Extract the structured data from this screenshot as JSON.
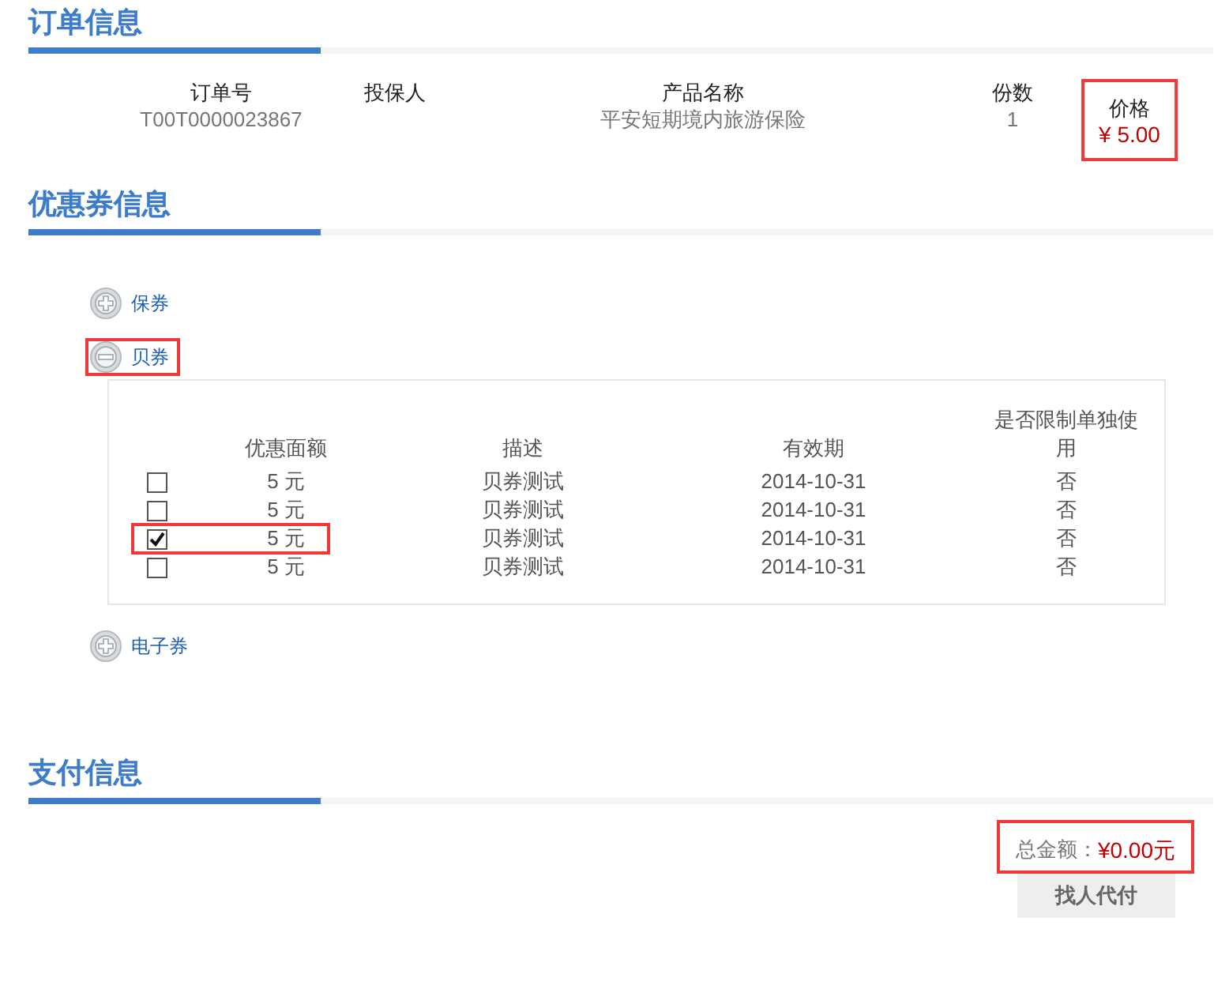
{
  "order": {
    "title": "订单信息",
    "columns": [
      {
        "header": "订单号",
        "value": "T00T0000023867",
        "highlighted": false
      },
      {
        "header": "投保人",
        "highlighted": false
      },
      {
        "header": "产品名称",
        "value": "平安短期境内旅游保险",
        "highlighted": false
      },
      {
        "header": "份数",
        "value": "1",
        "highlighted": false
      },
      {
        "header": "价格",
        "value": "¥ 5.00",
        "kind": "price",
        "highlighted": true
      }
    ]
  },
  "coupons": {
    "title": "优惠券信息",
    "groups": [
      {
        "label": "保券",
        "expanded": false,
        "highlighted": false
      },
      {
        "label": "贝券",
        "expanded": true,
        "highlighted": true,
        "table": {
          "columns": [
            "优惠面额",
            "描述",
            "有效期",
            "是否限制单独使用"
          ],
          "rows": [
            {
              "checked": false,
              "highlighted": false,
              "cells": [
                "5 元",
                "贝券测试",
                "2014-10-31",
                "否"
              ]
            },
            {
              "checked": false,
              "highlighted": false,
              "cells": [
                "5 元",
                "贝券测试",
                "2014-10-31",
                "否"
              ]
            },
            {
              "checked": true,
              "highlighted": true,
              "cells": [
                "5 元",
                "贝券测试",
                "2014-10-31",
                "否"
              ]
            },
            {
              "checked": false,
              "highlighted": false,
              "cells": [
                "5 元",
                "贝券测试",
                "2014-10-31",
                "否"
              ]
            }
          ]
        }
      },
      {
        "label": "电子券",
        "expanded": false,
        "highlighted": false
      }
    ]
  },
  "payment": {
    "title": "支付信息",
    "total_label": "总金额：",
    "total_value": "¥0.00元",
    "highlighted": true,
    "button": "找人代付"
  }
}
